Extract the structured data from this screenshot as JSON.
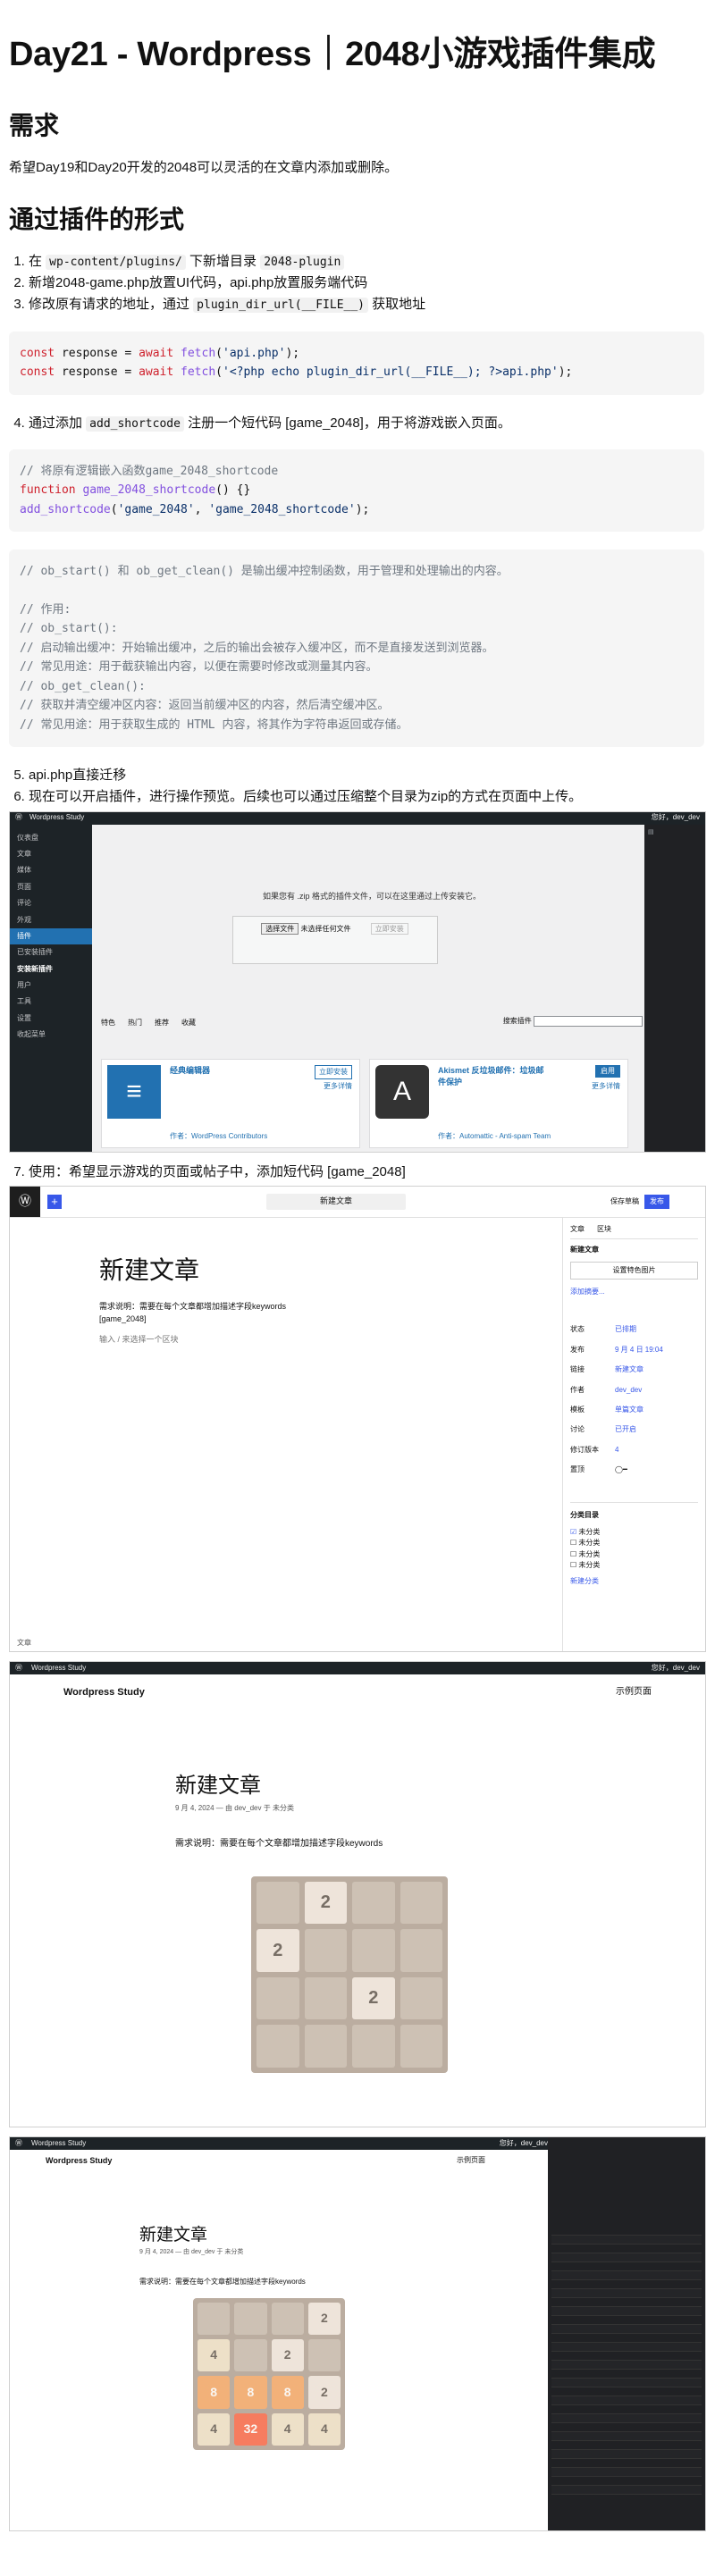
{
  "title": "Day21 - Wordpress｜2048小游戏插件集成",
  "section_need": {
    "heading": "需求",
    "text": "希望Day19和Day20开发的2048可以灵活的在文章内添加或删除。"
  },
  "section_plugin": {
    "heading": "通过插件的形式",
    "step1_prefix": "在 ",
    "step1_code1": "wp-content/plugins/",
    "step1_mid": " 下新增目录 ",
    "step1_code2": "2048-plugin",
    "step2": "新增2048-game.php放置UI代码，api.php放置服务端代码",
    "step3_prefix": "修改原有请求的地址，通过 ",
    "step3_code": "plugin_dir_url(__FILE__)",
    "step3_suffix": " 获取地址",
    "step4_prefix": "通过添加 ",
    "step4_code": "add_shortcode",
    "step4_suffix": " 注册一个短代码 [game_2048]，用于将游戏嵌入页面。",
    "step5": "api.php直接迁移",
    "step6": "现在可以开启插件，进行操作预览。后续也可以通过压缩整个目录为zip的方式在页面中上传。",
    "step7": "使用：希望显示游戏的页面或帖子中，添加短代码 [game_2048]"
  },
  "code_block1": {
    "line1_kw": "const",
    "line1_a": " response = ",
    "line1_kw2": "await",
    "line1_fn": " fetch",
    "line1_b": "(",
    "line1_str": "'api.php'",
    "line1_c": ");",
    "line2_kw": "const",
    "line2_a": " response = ",
    "line2_kw2": "await",
    "line2_fn": " fetch",
    "line2_b": "(",
    "line2_str": "'<?php echo plugin_dir_url(__FILE__); ?>api.php'",
    "line2_c": ");"
  },
  "code_block2": {
    "comment": "// 将原有逻辑嵌入函数game_2048_shortcode",
    "line2_kw": "function",
    "line2_fn": " game_2048_shortcode",
    "line2_rest": "() {}",
    "line3_fn": "add_shortcode",
    "line3_a": "(",
    "line3_str1": "'game_2048'",
    "line3_b": ", ",
    "line3_str2": "'game_2048_shortcode'",
    "line3_c": ");"
  },
  "code_block3": {
    "lines": [
      "// ob_start() 和 ob_get_clean() 是输出缓冲控制函数，用于管理和处理输出的内容。",
      "",
      "// 作用:",
      "// ob_start():",
      "// 启动输出缓冲：开始输出缓冲，之后的输出会被存入缓冲区，而不是直接发送到浏览器。",
      "// 常见用途：用于截获输出内容，以便在需要时修改或测量其内容。",
      "// ob_get_clean():",
      "// 获取并清空缓冲区内容：返回当前缓冲区的内容，然后清空缓冲区。",
      "// 常见用途：用于获取生成的 HTML 内容，将其作为字符串返回或存储。"
    ]
  },
  "admin_shot": {
    "site": "Wordpress Study",
    "menu": [
      "仪表盘",
      "文章",
      "媒体",
      "页面",
      "评论",
      "外观",
      "插件",
      "已安装插件",
      "安装新插件",
      "用户",
      "工具",
      "设置",
      "收起菜单"
    ],
    "upload_hint": "如果您有 .zip 格式的插件文件，可以在这里通过上传安装它。",
    "choose_file": "选择文件",
    "no_file": "未选择任何文件",
    "install_now": "立即安装",
    "tabs": [
      "特色",
      "热门",
      "推荐",
      "收藏"
    ],
    "search_label": "搜索插件",
    "card1_title": "经典编辑器",
    "card1_btn": "立即安装",
    "card1_more": "更多详情",
    "card1_author": "作者：WordPress Contributors",
    "card2_title": "Akismet 反垃圾邮件：垃圾邮件保护",
    "card2_btn": "启用",
    "card2_more": "更多详情",
    "card2_author": "作者：Automattic - Anti-spam Team",
    "user": "您好，dev_dev"
  },
  "editor_shot": {
    "doc_title": "新建文章",
    "heading": "新建文章",
    "para": "需求说明：需要在每个文章都增加描述字段keywords",
    "shortcode": "[game_2048]",
    "placeholder": "输入 / 来选择一个区块",
    "save_label": "保存草稿",
    "publish_label": "发布",
    "side_tab1": "文章",
    "side_tab2": "区块",
    "side_title": "新建文章",
    "set_image": "设置特色图片",
    "add_excerpt": "添加摘要...",
    "status_label": "状态",
    "status_value": "已排期",
    "publish_label2": "发布",
    "publish_value": "9 月 4 日 19:04",
    "link_label": "链接",
    "author_label": "作者",
    "author_value": "dev_dev",
    "template_label": "模板",
    "template_value": "单篇文章",
    "discussion_label": "讨论",
    "discussion_value": "已开启",
    "revisions_label": "修订版本",
    "revisions_value": "4",
    "sticky_label": "置顶",
    "categories_heading": "分类目录",
    "categories": [
      "未分类",
      "未分类",
      "未分类",
      "未分类"
    ],
    "add_category": "新建分类",
    "footer": "文章"
  },
  "game_shot1": {
    "site": "Wordpress Study",
    "sample_page": "示例页面",
    "post_title": "新建文章",
    "meta": "9 月 4, 2024 — 由 dev_dev 于 未分类",
    "para": "需求说明：需要在每个文章都增加描述字段keywords",
    "user": "您好，dev_dev",
    "board": [
      [
        0,
        2,
        0,
        0
      ],
      [
        2,
        0,
        0,
        0
      ],
      [
        0,
        0,
        2,
        0
      ],
      [
        0,
        0,
        0,
        0
      ]
    ]
  },
  "game_shot2": {
    "site": "Wordpress Study",
    "sample_page": "示例页面",
    "post_title": "新建文章",
    "meta": "9 月 4, 2024 — 由 dev_dev 于 未分类",
    "para": "需求说明：需要在每个文章都增加描述字段keywords",
    "user": "您好，dev_dev",
    "board": [
      [
        0,
        0,
        0,
        2
      ],
      [
        4,
        0,
        2,
        0
      ],
      [
        8,
        8,
        8,
        2
      ],
      [
        4,
        32,
        4,
        4
      ]
    ],
    "network_rows": 30
  }
}
